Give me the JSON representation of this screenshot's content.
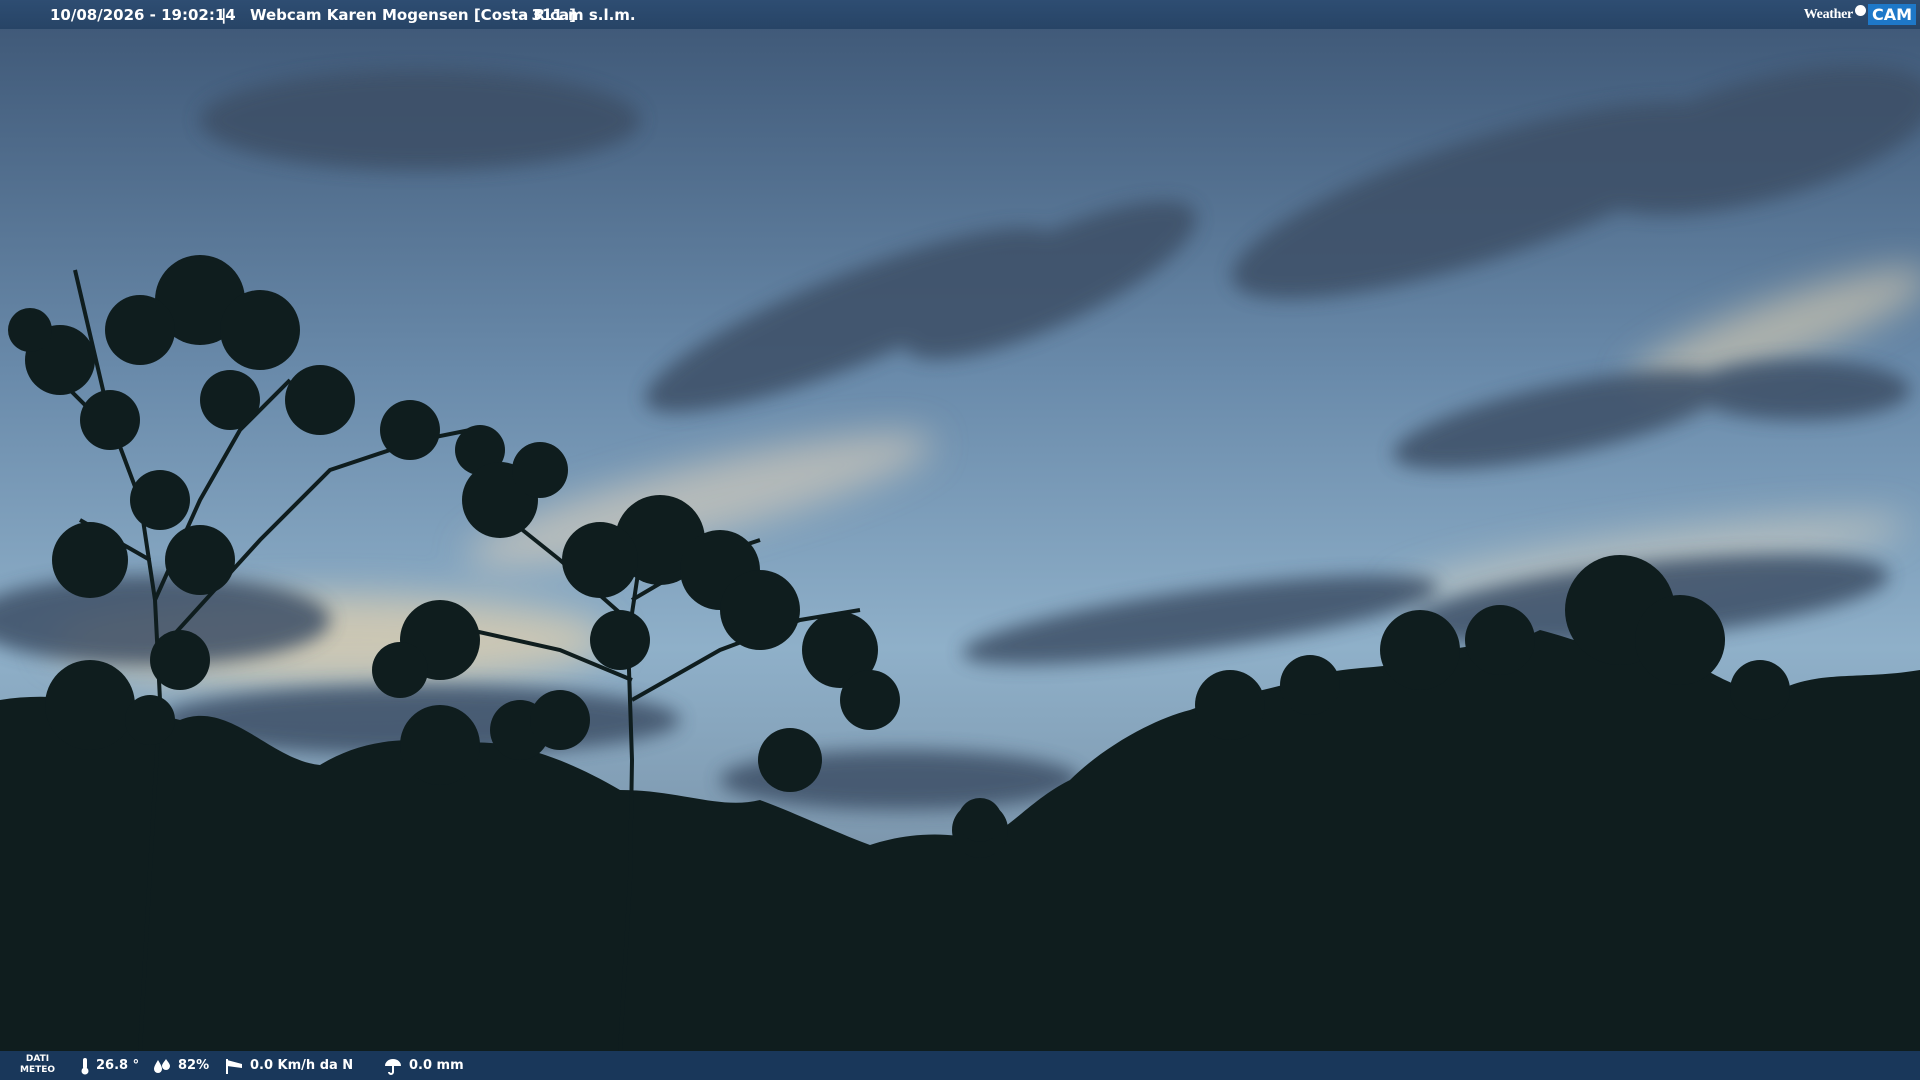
{
  "header": {
    "timestamp": "10/08/2026 - 19:02:14",
    "separator": "|",
    "title": "Webcam Karen Mogensen [Costa Rica]",
    "altitude": "- 311 m s.l.m.",
    "logo_left": "Weather",
    "logo_right": "CAM"
  },
  "footer": {
    "label_line1": "DATI",
    "label_line2": "METEO",
    "temperature": "26.8 °",
    "humidity": "82%",
    "wind": "0.0 Km/h da N",
    "rain": "0.0 mm"
  },
  "icons": {
    "temperature": "thermometer-icon",
    "humidity": "drops-icon",
    "wind": "wind-sock-icon",
    "rain": "umbrella-icon"
  },
  "colors": {
    "top_bar": "#2e4d72",
    "bottom_bar": "#19375a",
    "logo_accent": "#1e78c8"
  }
}
